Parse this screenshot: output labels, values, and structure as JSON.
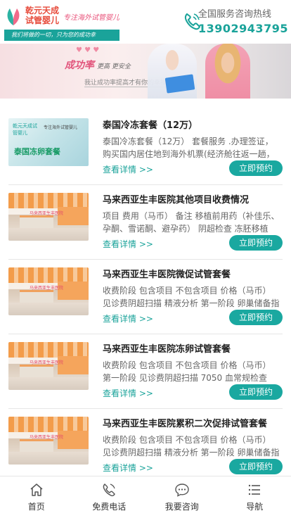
{
  "header": {
    "brand_name": "乾元天成试管婴儿",
    "slogan": "专注海外试管婴儿",
    "tagline": "我们将做的一切，只为您的成功幸",
    "hotline_label": "全国服务咨询热线",
    "hotline_number": "13902943795"
  },
  "banner": {
    "title": "成功率",
    "title_small": "更高 更安全",
    "subtitle": "我让成功率提高才有你的幸福",
    "decor": "♥ ♥ ♥"
  },
  "items": [
    {
      "title": "泰国冷冻套餐（12万）",
      "desc": "泰国冷冻套餐（12万） 套餐服务 .办理签证，购买国内居住地到海外机票(经济舱往返一趟，签",
      "more": "查看详情 >>",
      "button": "立即预约",
      "thumb_type": "frozen",
      "thumb_title": "泰国冻卵套餐",
      "thumb_sub": "专注海外试管婴儿"
    },
    {
      "title": "马来西亚生丰医院其他项目收费情况",
      "desc": "项目 费用（马币） 备注 移植前用药（补佳乐、孕酮、雪诺酮、避孕药） 阴超检查 冻胚移植",
      "more": "查看详情 >>",
      "button": "立即预约",
      "thumb_type": "hospital",
      "thumb_sign": "马来西亚生丰医院"
    },
    {
      "title": "马来西亚生丰医院微促试管套餐",
      "desc": "收费阶段 包含项目 不包含项目 价格（马币） 见诊费阴超扫描 精液分析 第一阶段 卵巢储备指",
      "more": "查看详情 >>",
      "button": "立即预约",
      "thumb_type": "hospital",
      "thumb_sign": "马来西亚生丰医院"
    },
    {
      "title": "马来西亚生丰医院冻卵试管套餐",
      "desc": "收费阶段 包含项目 不包含项目 价格（马币） 第一阶段 见诊费阴超扫描 7050 血常规检查AMH",
      "more": "查看详情 >>",
      "button": "立即预约",
      "thumb_type": "hospital",
      "thumb_sign": "马来西亚生丰医院"
    },
    {
      "title": "马来西亚生丰医院累积二次促排试管套餐",
      "desc": "收费阶段 包含项目 不包含项目 价格（马币） 见诊费阴超扫描 精液分析 第一阶段 卵巢储备指",
      "more": "查看详情 >>",
      "button": "立即预约",
      "thumb_type": "hospital",
      "thumb_sign": "马来西亚生丰医院"
    }
  ],
  "bottom_nav": [
    {
      "label": "首页",
      "icon": "home-icon"
    },
    {
      "label": "免费电话",
      "icon": "phone-icon"
    },
    {
      "label": "我要咨询",
      "icon": "chat-icon"
    },
    {
      "label": "导航",
      "icon": "menu-icon"
    }
  ],
  "colors": {
    "accent": "#1aa39a",
    "button": "#1aa8a0"
  }
}
